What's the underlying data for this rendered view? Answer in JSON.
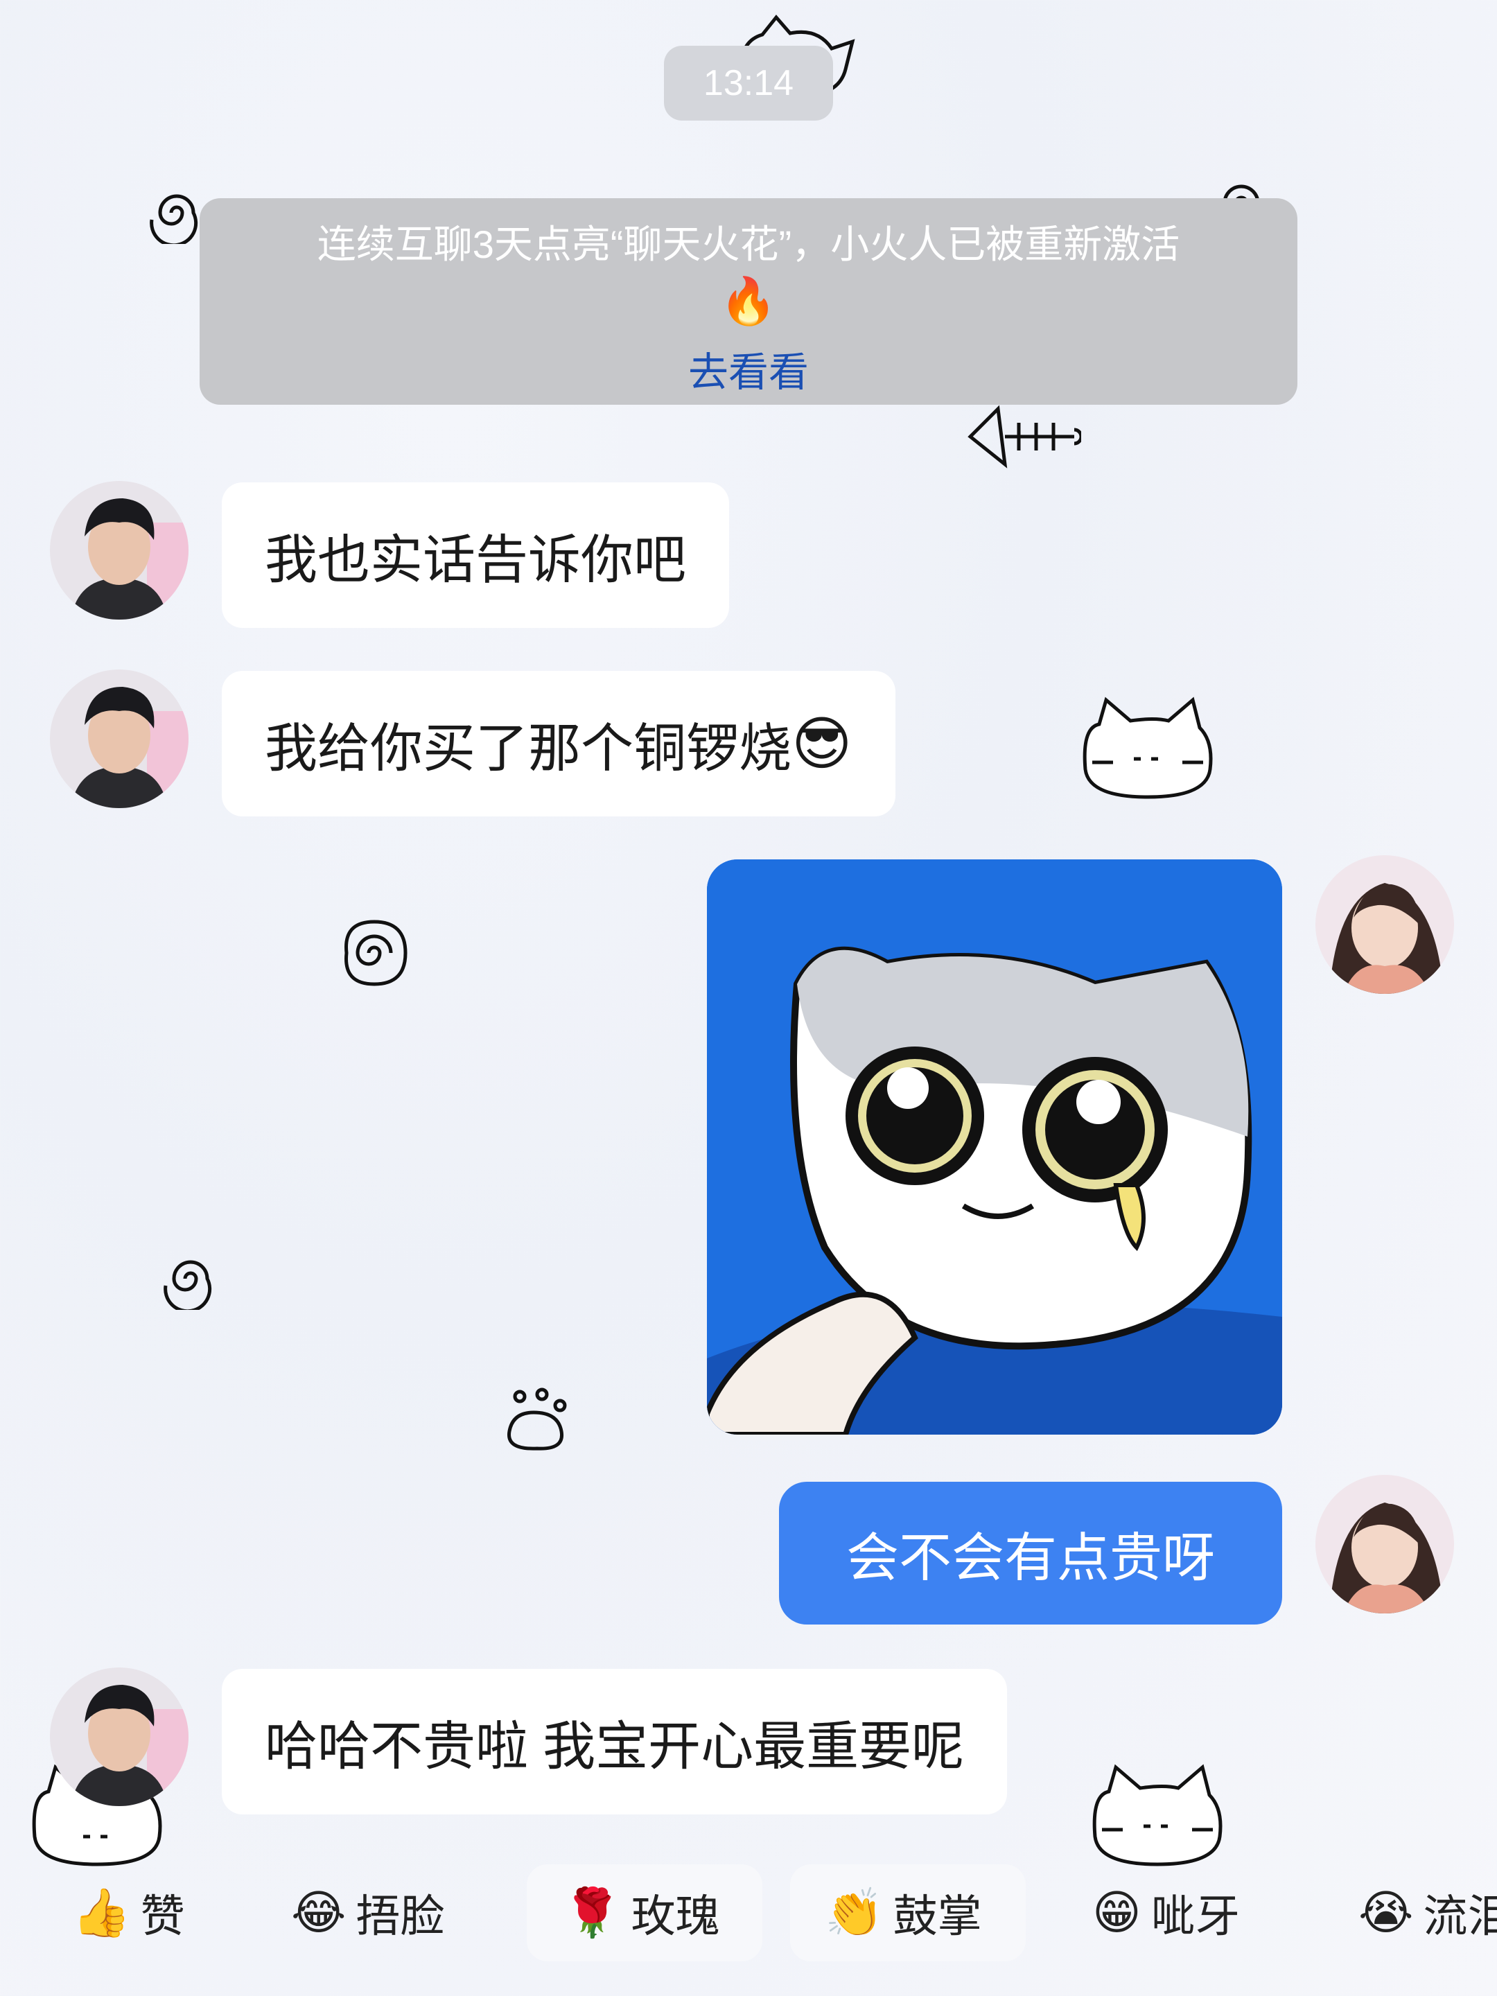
{
  "header": {
    "time": "13:14"
  },
  "notice": {
    "text": "连续互聊3天点亮“聊天火花”，小火人已被重新激活",
    "fire_icon": "🔥",
    "link_label": "去看看"
  },
  "messages": {
    "m1": {
      "text": "我也实话告诉你吧"
    },
    "m2": {
      "text": "我给你买了那个铜锣烧",
      "emoji": "😎"
    },
    "m3": {
      "type": "sticker",
      "sticker_name": "crying-cat-sticker"
    },
    "m4": {
      "text": "会不会有点贵呀"
    },
    "m5": {
      "text": "哈哈不贵啦 我宝开心最重要呢"
    }
  },
  "reactions": [
    {
      "emoji": "👍",
      "label": "赞"
    },
    {
      "emoji": "😂",
      "label": "捂脸"
    },
    {
      "emoji": "🌹",
      "label": "玫瑰"
    },
    {
      "emoji": "👏",
      "label": "鼓掌"
    },
    {
      "emoji": "😁",
      "label": "呲牙"
    },
    {
      "emoji": "😭",
      "label": "流泪"
    }
  ],
  "colors": {
    "outgoing_bubble": "#3d82f2",
    "incoming_bubble": "#ffffff",
    "notice_bg": "#c6c7ca",
    "link": "#1a4fb3",
    "sticker_bg": "#1e6fe0"
  }
}
